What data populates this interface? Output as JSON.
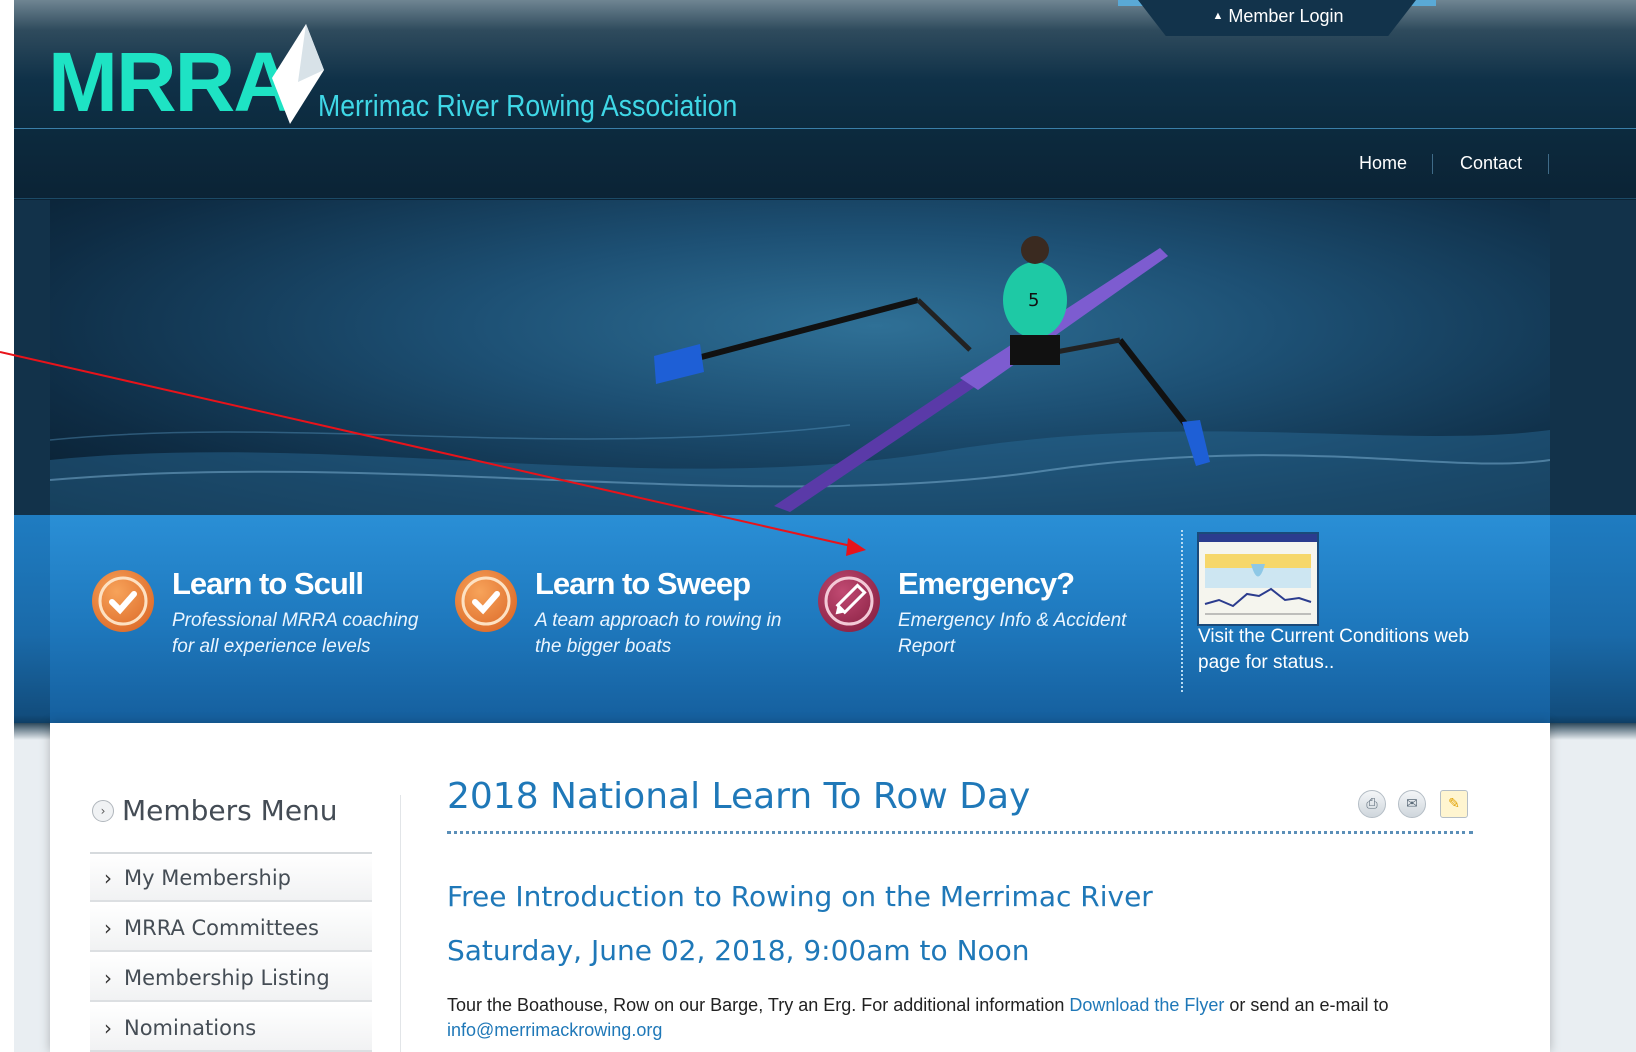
{
  "header": {
    "logo": "MRRA",
    "subtitle": "Merrimac River Rowing Association",
    "member_login": "Member Login",
    "nav": [
      "Home",
      "Contact"
    ]
  },
  "features": [
    {
      "title": "Learn to Scull",
      "desc": "Professional MRRA coaching for all experience levels",
      "icon": "check-icon"
    },
    {
      "title": "Learn to Sweep",
      "desc": "A team approach to rowing in the bigger boats",
      "icon": "check-icon"
    },
    {
      "title": "Emergency?",
      "desc": "Emergency Info & Accident Report",
      "icon": "pencil-icon"
    }
  ],
  "conditions": {
    "text": "Visit the Current Conditions web page for status.."
  },
  "sidebar": {
    "title": "Members Menu",
    "items": [
      "My Membership",
      "MRRA Committees",
      "Membership Listing",
      "Nominations"
    ]
  },
  "article": {
    "title": "2018 National Learn To Row Day",
    "subhead1": "Free Introduction to Rowing on the Merrimac River",
    "subhead2": "Saturday, June 02, 2018, 9:00am to Noon",
    "body_before": "Tour the Boathouse, Row on our Barge, Try an Erg. For additional information ",
    "flyer_link": "Download the Flyer",
    "body_middle": " or send an e-mail to ",
    "email_link": "info@merrimackrowing.org",
    "icons": [
      "print-icon",
      "email-icon",
      "edit-icon"
    ]
  },
  "colors": {
    "logo": "#1ee3c4",
    "link": "#1f78b8",
    "check_icon": "#e8732c",
    "emergency_icon": "#8e1f45",
    "annotation_arrow": "#e8131a"
  }
}
